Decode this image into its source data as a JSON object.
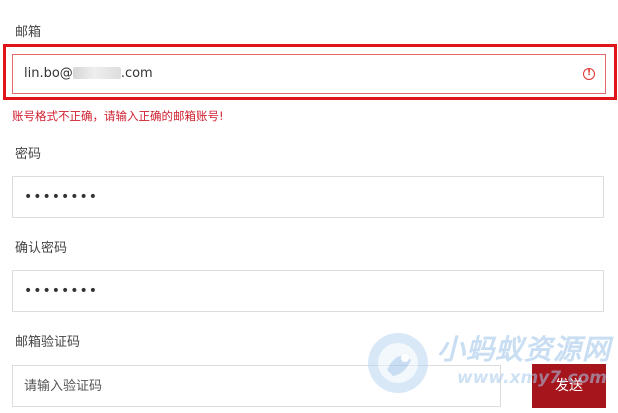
{
  "email": {
    "label": "邮箱",
    "value_prefix": "lin.bo@",
    "value_suffix": ".com",
    "error": "账号格式不正确，请输入正确的邮箱账号!"
  },
  "password": {
    "label": "密码",
    "value": "••••••••"
  },
  "confirm_password": {
    "label": "确认密码",
    "value": "••••••••"
  },
  "verify_code": {
    "label": "邮箱验证码",
    "placeholder": "请输入验证码",
    "send_label": "发送"
  },
  "watermark": {
    "text": "小蚂蚁资源网",
    "url": "www.xmy7.com"
  },
  "colors": {
    "error": "#d01f2f",
    "highlight": "#e0141b",
    "send_button": "#a5151b",
    "watermark": "#9ec4ea"
  }
}
